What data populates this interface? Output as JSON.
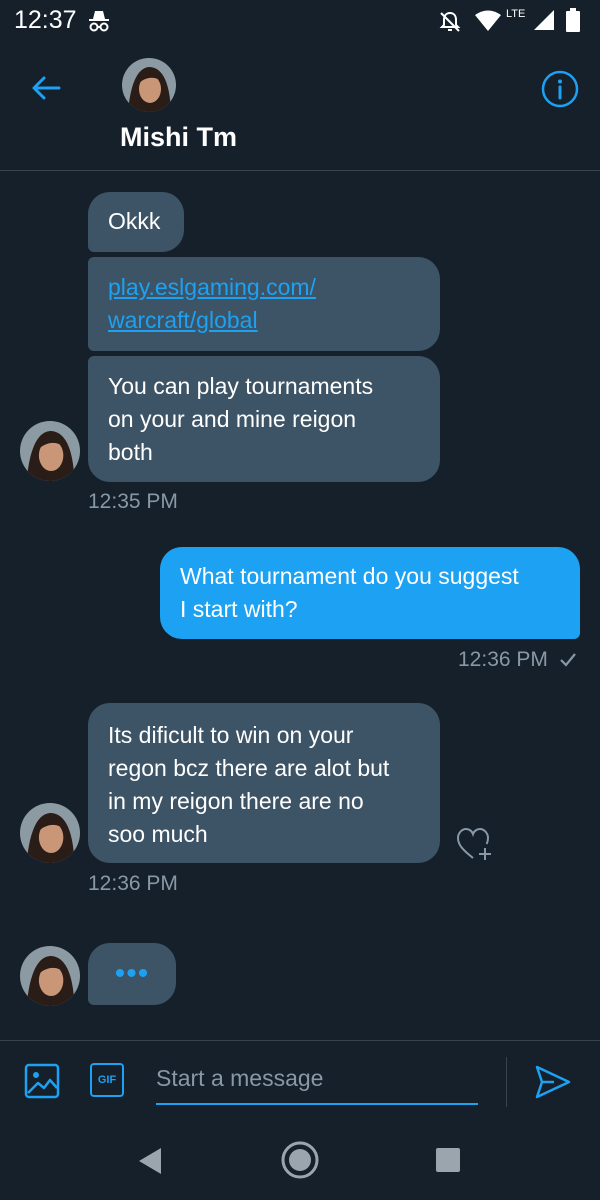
{
  "status_bar": {
    "time": "12:37",
    "network": "LTE",
    "icons": [
      "incognito-icon",
      "notifications-off-icon",
      "wifi-icon",
      "signal-icon",
      "battery-icon"
    ]
  },
  "header": {
    "contact_name": "Mishi Tm",
    "back_icon": "arrow-left-icon",
    "info_icon": "info-icon"
  },
  "messages": [
    {
      "direction": "incoming",
      "text": "Okkk"
    },
    {
      "direction": "incoming",
      "link_line1": "play.eslgaming.com/",
      "link_line2": "warcraft/global"
    },
    {
      "direction": "incoming",
      "line1": "You can play tournaments",
      "line2": "on your and mine reigon",
      "line3": "both",
      "timestamp": "12:35 PM"
    },
    {
      "direction": "outgoing",
      "line1": "What tournament do you suggest",
      "line2": "I start with?",
      "timestamp": "12:36 PM",
      "status": "sent"
    },
    {
      "direction": "incoming",
      "line1": "Its dificult to win on your",
      "line2": "regon bcz there are alot but",
      "line3": "in my reigon there are no",
      "line4": "soo much",
      "timestamp": "12:36 PM"
    }
  ],
  "typing_indicator": "•••",
  "composer": {
    "placeholder": "Start a message",
    "gif_label": "GIF"
  },
  "colors": {
    "background": "#15202b",
    "incoming_bubble": "#3d5466",
    "outgoing_bubble": "#1da1f2",
    "accent": "#1da1f2",
    "muted_text": "#8899a6"
  }
}
